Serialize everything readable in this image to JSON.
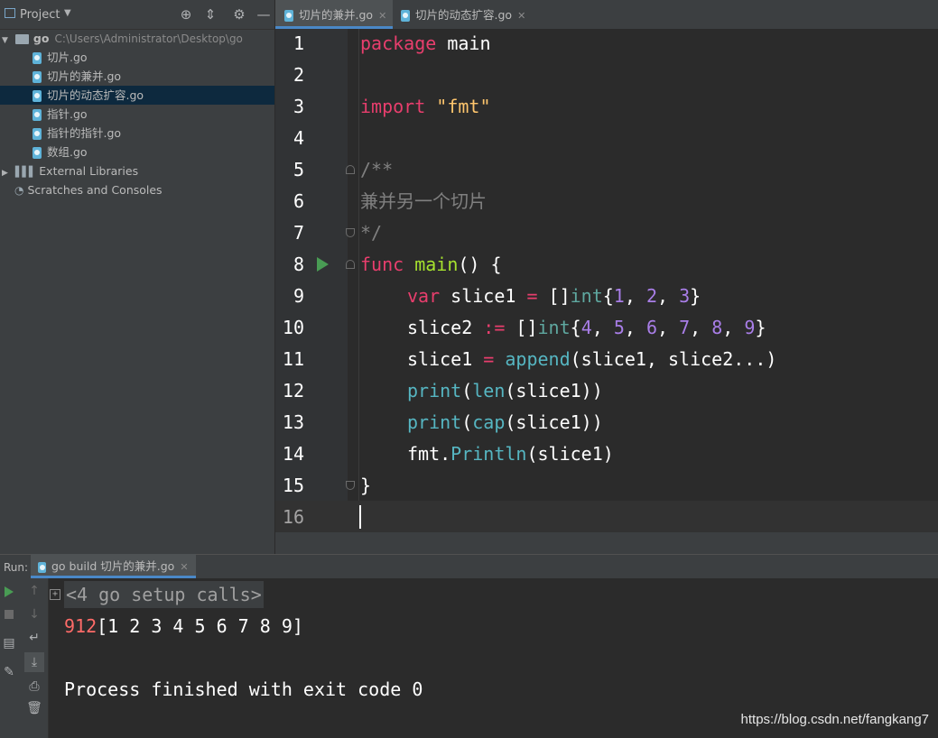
{
  "project_panel": {
    "title": "Project",
    "root": {
      "name": "go",
      "path": "C:\\Users\\Administrator\\Desktop\\go"
    },
    "files": [
      "切片.go",
      "切片的兼并.go",
      "切片的动态扩容.go",
      "指针.go",
      "指针的指针.go",
      "数组.go"
    ],
    "selected_index": 2,
    "external_libraries": "External Libraries",
    "scratches": "Scratches and Consoles"
  },
  "editor_tabs": [
    {
      "label": "切片的兼并.go",
      "active": true
    },
    {
      "label": "切片的动态扩容.go",
      "active": false
    }
  ],
  "editor": {
    "line_numbers": [
      "1",
      "2",
      "3",
      "4",
      "5",
      "6",
      "7",
      "8",
      "9",
      "10",
      "11",
      "12",
      "13",
      "14",
      "15",
      "16"
    ],
    "current_line": "16",
    "code": {
      "l1_kw": "package",
      "l1_rest": " main",
      "l3_kw": "import",
      "l3_str": " \"fmt\"",
      "l5": "/**",
      "l6": "兼并另一个切片",
      "l7": "*/",
      "l8_kw": "func",
      "l8_fn": " main",
      "l8_rest": "() {",
      "l9_kw": "var",
      "l9_a": " slice1 ",
      "l9_op": "=",
      "l9_b": " []",
      "l9_t": "int",
      "l9_c": "{",
      "l9_n1": "1",
      "l9_d": ", ",
      "l9_n2": "2",
      "l9_e": ", ",
      "l9_n3": "3",
      "l9_f": "}",
      "l10_a": "slice2 ",
      "l10_op": ":=",
      "l10_b": " []",
      "l10_t": "int",
      "l10_c": "{",
      "l10_n1": "4",
      "l10_s1": ", ",
      "l10_n2": "5",
      "l10_s2": ", ",
      "l10_n3": "6",
      "l10_s3": ", ",
      "l10_n4": "7",
      "l10_s4": ", ",
      "l10_n5": "8",
      "l10_s5": ", ",
      "l10_n6": "9",
      "l10_d": "}",
      "l11_a": "slice1 ",
      "l11_op": "=",
      "l11_sp": " ",
      "l11_fn": "append",
      "l11_b": "(slice1, slice2...)",
      "l12_fn": "print",
      "l12_a": "(",
      "l12_fn2": "len",
      "l12_b": "(slice1))",
      "l13_fn": "print",
      "l13_a": "(",
      "l13_fn2": "cap",
      "l13_b": "(slice1))",
      "l14_a": "fmt.",
      "l14_fn": "Println",
      "l14_b": "(slice1)",
      "l15": "}"
    }
  },
  "run_panel": {
    "label": "Run:",
    "tab_label": "go build 切片的兼并.go",
    "output": {
      "setup_calls": "<4 go setup calls>",
      "line1_prefix": "912",
      "line1_rest": "[1 2 3 4 5 6 7 8 9]",
      "finished": "Process finished with exit code 0"
    }
  },
  "watermark": "https://blog.csdn.net/fangkang7",
  "colors": {
    "keyword": "#e83e6d",
    "function": "#ffc66d",
    "number": "#a97ee8",
    "string": "#6a8759",
    "comment": "#808080",
    "accent": "#4a88c7"
  }
}
